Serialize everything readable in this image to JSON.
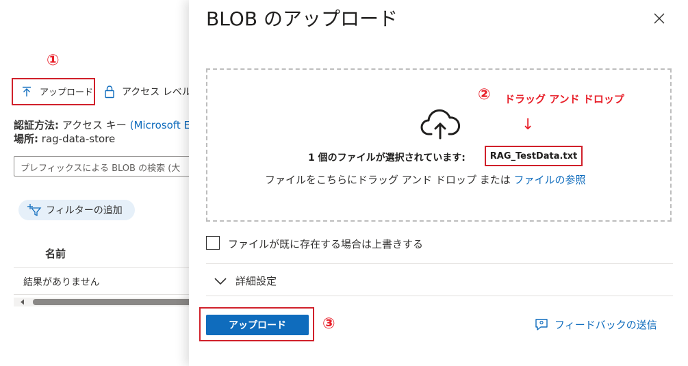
{
  "background_page": {
    "toolbar": {
      "upload_label": "アップロード",
      "access_level_label": "アクセス レベル"
    },
    "auth_method_label": "認証方法:",
    "auth_method_value": "アクセス キー",
    "auth_method_link": "(Microsoft E",
    "location_label": "場所:",
    "location_value": "rag-data-store",
    "search_placeholder": "プレフィックスによる BLOB の検索 (大",
    "filter_button_label": "フィルターの追加",
    "table": {
      "column_name": "名前",
      "empty_message": "結果がありません"
    }
  },
  "panel": {
    "title": "BLOB のアップロード",
    "selected_files_text": "1 個のファイルが選択されています:",
    "selected_file_name": "RAG_TestData.txt",
    "drop_hint": "ファイルをこちらにドラッグ アンド ドロップ または",
    "browse_link": "ファイルの参照",
    "overwrite_label": "ファイルが既に存在する場合は上書きする",
    "overwrite_checked": false,
    "advanced_label": "詳細設定",
    "upload_button_label": "アップロード",
    "feedback_label": "フィードバックの送信"
  },
  "annotations": {
    "step1": "①",
    "step2": "②",
    "step2_text": "ドラッグ アンド ドロップ",
    "arrow": "↓",
    "step3": "③"
  },
  "colors": {
    "accent": "#0f6cbd",
    "annotation_red": "#e8202a"
  }
}
